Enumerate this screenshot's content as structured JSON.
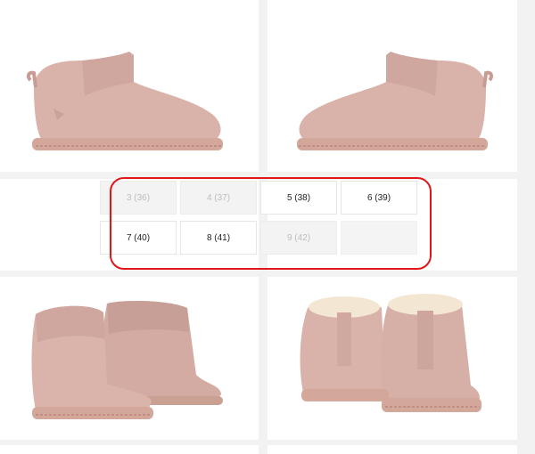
{
  "sizes": [
    {
      "label": "3 (36)",
      "available": false
    },
    {
      "label": "4 (37)",
      "available": false
    },
    {
      "label": "5 (38)",
      "available": true
    },
    {
      "label": "6 (39)",
      "available": true
    },
    {
      "label": "7 (40)",
      "available": true
    },
    {
      "label": "8 (41)",
      "available": true
    },
    {
      "label": "9 (42)",
      "available": false
    }
  ],
  "images": [
    {
      "name": "boot-side-left"
    },
    {
      "name": "boot-side-right"
    },
    {
      "name": "boot-pair-front"
    },
    {
      "name": "boot-pair-back"
    }
  ],
  "colors": {
    "boot": "#d9b2a9",
    "boot_dark": "#b88f87",
    "sole": "#d4a79b",
    "fur": "#f3e6d2",
    "highlight": "#e0161a"
  }
}
